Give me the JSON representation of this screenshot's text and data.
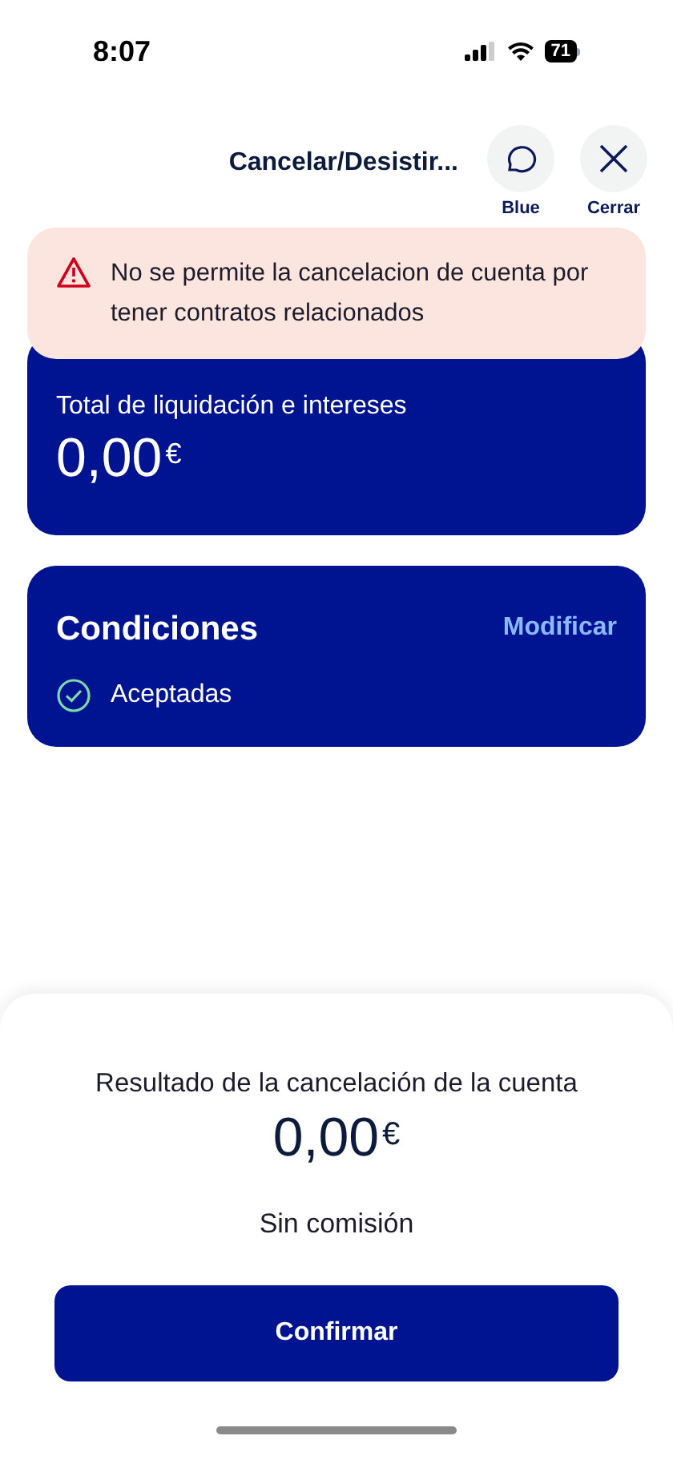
{
  "status_bar": {
    "time": "8:07",
    "battery": "71"
  },
  "header": {
    "title": "Cancelar/Desistir...",
    "actions": [
      {
        "kind": "chat",
        "label": "Blue"
      },
      {
        "kind": "close",
        "label": "Cerrar"
      }
    ]
  },
  "alert": {
    "message": "No se permite la cancelacion de cuenta por tener contratos relacionados"
  },
  "total_card": {
    "label": "Total de liquidación e intereses",
    "amount": "0,00",
    "currency": "€"
  },
  "conditions": {
    "title": "Condiciones",
    "action": "Modificar",
    "status": "Aceptadas",
    "accepted": true
  },
  "summary": {
    "label": "Resultado de la cancelación de la cuenta",
    "amount": "0,00",
    "currency": "€",
    "note": "Sin comisión",
    "button": "Confirmar"
  }
}
